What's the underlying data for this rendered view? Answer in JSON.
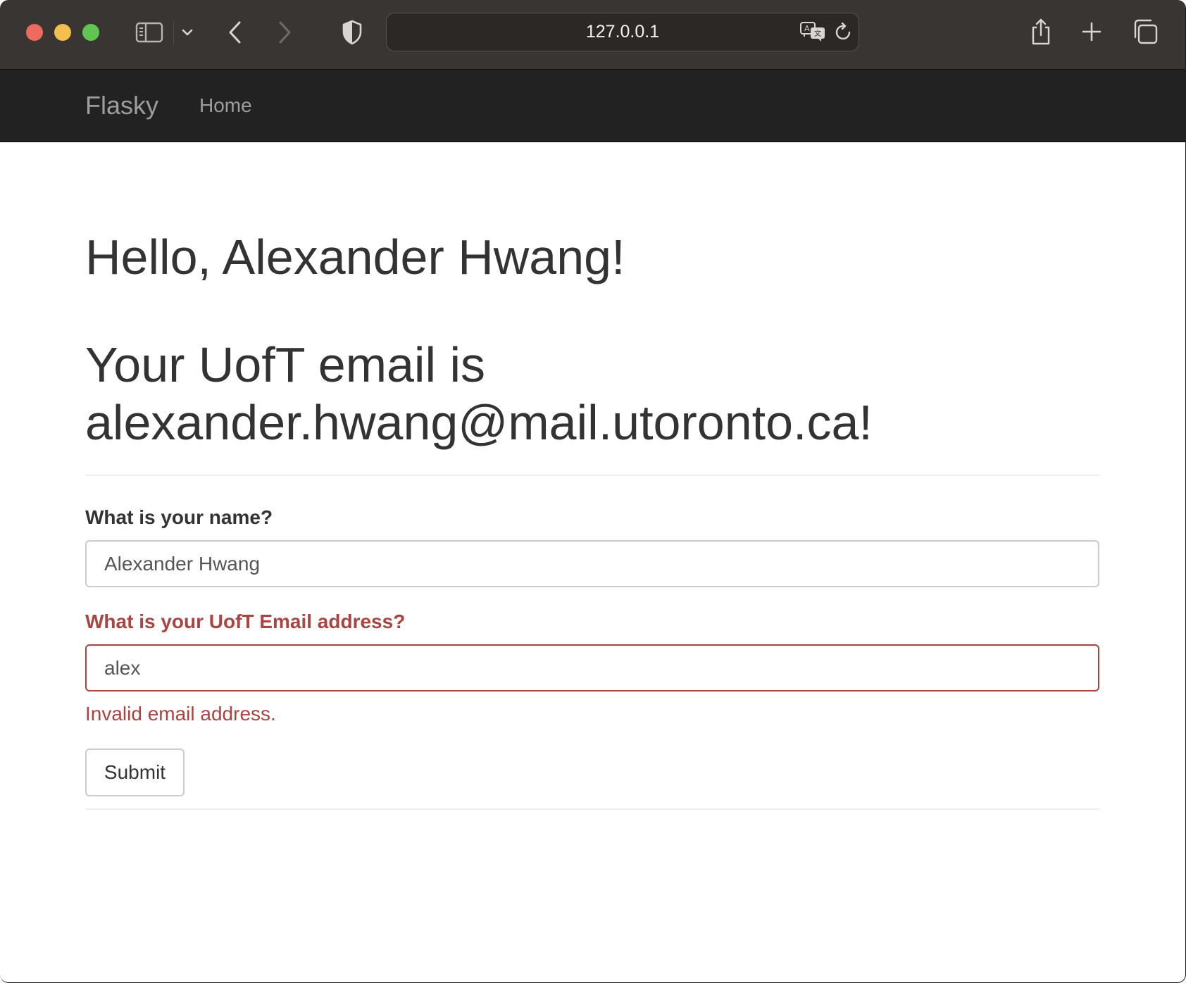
{
  "browser": {
    "url": "127.0.0.1"
  },
  "navbar": {
    "brand": "Flasky",
    "links": [
      {
        "label": "Home"
      }
    ]
  },
  "main": {
    "greeting": "Hello, Alexander Hwang!",
    "email_heading": "Your UofT email is alexander.hwang@mail.utoronto.ca!",
    "form": {
      "name_label": "What is your name?",
      "name_value": "Alexander Hwang",
      "email_label": "What is your UofT Email address?",
      "email_value": "alex",
      "email_error": "Invalid email address.",
      "submit_label": "Submit"
    }
  },
  "colors": {
    "navbar_bg": "#222222",
    "error": "#a94442",
    "heading_text": "#333333"
  }
}
